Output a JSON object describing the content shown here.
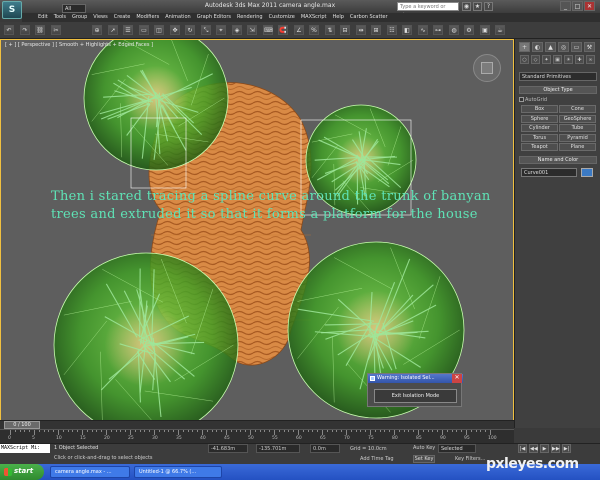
{
  "window": {
    "app_logo": "S",
    "title": "Autodesk 3ds Max  2011     camera angle.max",
    "search_placeholder": "Type a keyword or phrase",
    "icons": [
      "binoculars-icon",
      "star-icon",
      "help-icon"
    ]
  },
  "menu": [
    "Edit",
    "Tools",
    "Group",
    "Views",
    "Create",
    "Modifiers",
    "Animation",
    "Graph Editors",
    "Rendering",
    "Customize",
    "MAXScript",
    "Help",
    "Carbon Scatter"
  ],
  "toolbar": {
    "selection_filter": "All",
    "icons": [
      "undo-icon",
      "redo-icon",
      "link-icon",
      "unlink-icon",
      "bind-icon",
      "select-icon",
      "select-by-name-icon",
      "rect-select-icon",
      "window-crossing-icon",
      "move-icon",
      "rotate-icon",
      "scale-icon",
      "ref-coord-icon",
      "pivot-icon",
      "manipulate-icon",
      "keyboard-icon",
      "snap-icon",
      "angle-snap-icon",
      "percent-snap-icon",
      "spinner-snap-icon",
      "named-selection-icon",
      "mirror-icon",
      "align-icon",
      "layer-icon",
      "graphite-icon",
      "curve-editor-icon",
      "schematic-icon",
      "material-editor-icon",
      "render-setup-icon",
      "render-frame-icon",
      "render-icon"
    ]
  },
  "viewport": {
    "label": "[ + ] [ Perspective ] [ Smooth + Highlights + Edged Faces ]",
    "overlay_text": "Then i stared tracing a spline curve around the trunk of banyan trees and extruded it so that it forms a platform for the house"
  },
  "dialog": {
    "title": "Warning: Isolated Sel...",
    "close": "✕",
    "button": "Exit Isolation Mode"
  },
  "command_panel": {
    "tabs": [
      "+",
      "◐",
      "▲",
      "◎",
      "▭",
      "⚒"
    ],
    "category_icons": [
      "○",
      "◇",
      "✦",
      "▣",
      "☀",
      "✚",
      "∞"
    ],
    "primitive_type": "Standard Primitives",
    "object_type_header": "Object Type",
    "autogrid": "AutoGrid",
    "buttons": [
      "Box",
      "Cone",
      "Sphere",
      "GeoSphere",
      "Cylinder",
      "Tube",
      "Torus",
      "Pyramid",
      "Teapot",
      "Plane"
    ],
    "name_color_header": "Name and Color",
    "name_value": "Curve001",
    "swatch_color": "#3b7ac4"
  },
  "timeline": {
    "slider": "0 / 100",
    "ticks": [
      "0",
      "5",
      "10",
      "15",
      "20",
      "25",
      "30",
      "35",
      "40",
      "45",
      "50",
      "55",
      "60",
      "65",
      "70",
      "75",
      "80",
      "85",
      "90",
      "95",
      "100"
    ]
  },
  "status": {
    "maxscript": "MAXScript Mi:",
    "objects": "1 Object Selected",
    "prompt": "Click or click-and-drag to select objects",
    "x": "-41.683m",
    "y": "-135.701m",
    "z": "0.0m",
    "grid": "Grid = 10.0cm",
    "add_time_tag": "Add Time Tag",
    "auto_key": "Auto Key",
    "selected": "Selected",
    "set_key": "Set Key",
    "key_filters": "Key Filters...",
    "playback": [
      "|◀",
      "◀◀",
      "▶",
      "▶▶",
      "▶|"
    ]
  },
  "taskbar": {
    "start": "start",
    "tasks": [
      "camera angle.max - ...",
      "Untitled-1 @ 66.7% (..."
    ]
  },
  "watermark": "pxleyes.com"
}
